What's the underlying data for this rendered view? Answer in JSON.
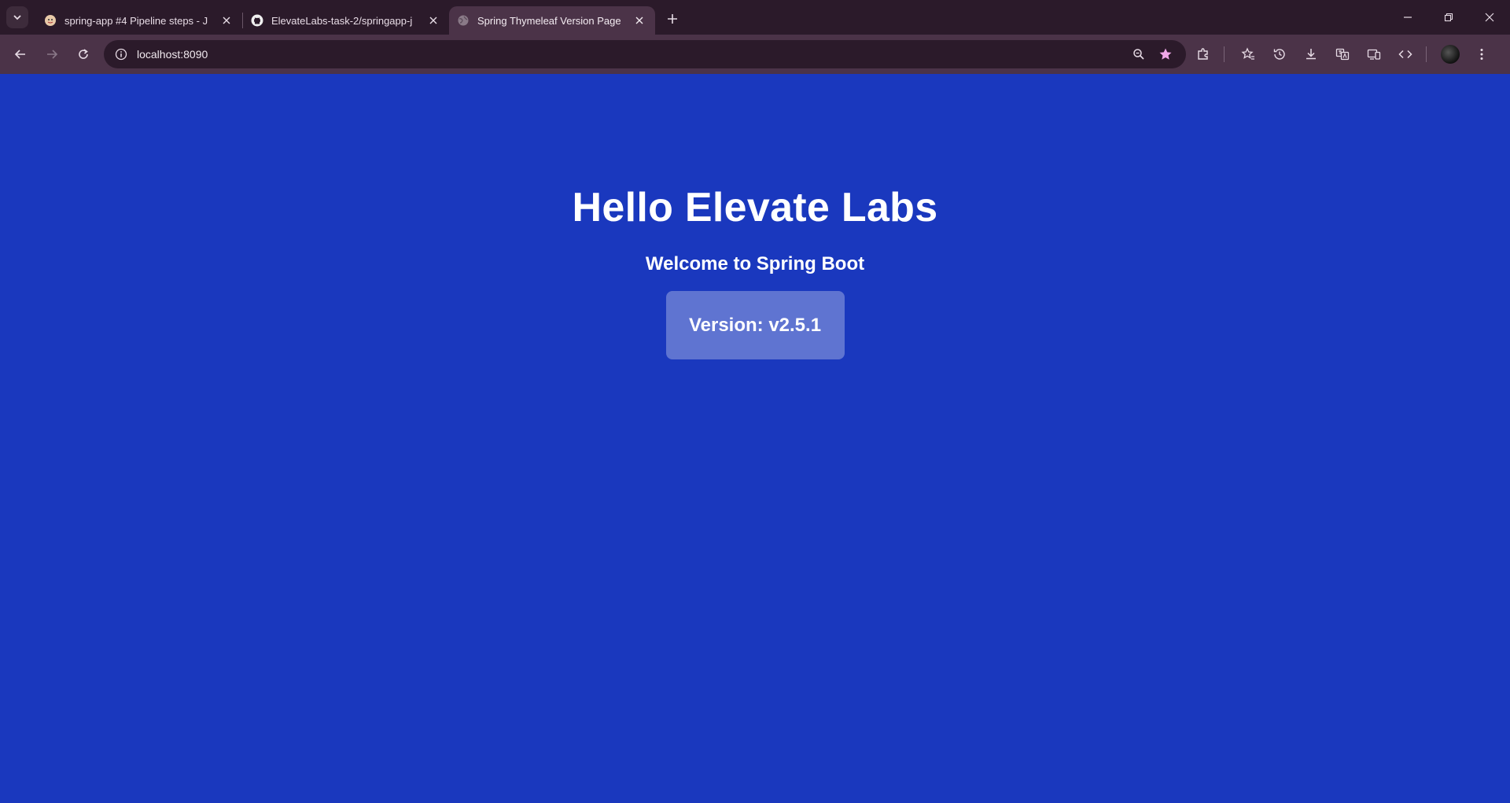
{
  "browser": {
    "tabs": [
      {
        "title": "spring-app #4 Pipeline steps - J",
        "favicon": "jenkins-icon",
        "active": false
      },
      {
        "title": "ElevateLabs-task-2/springapp-j",
        "favicon": "github-icon",
        "active": false
      },
      {
        "title": "Spring Thymeleaf Version Page",
        "favicon": "globe-icon",
        "active": true
      }
    ],
    "address": "localhost:8090",
    "colors": {
      "tabstrip": "#2b1a2a",
      "toolbar": "#4b3348",
      "star": "#f0a8e8"
    }
  },
  "page": {
    "heading": "Hello Elevate Labs",
    "subheading": "Welcome to Spring Boot",
    "version": "Version: v2.5.1",
    "background": "#1a38be"
  }
}
